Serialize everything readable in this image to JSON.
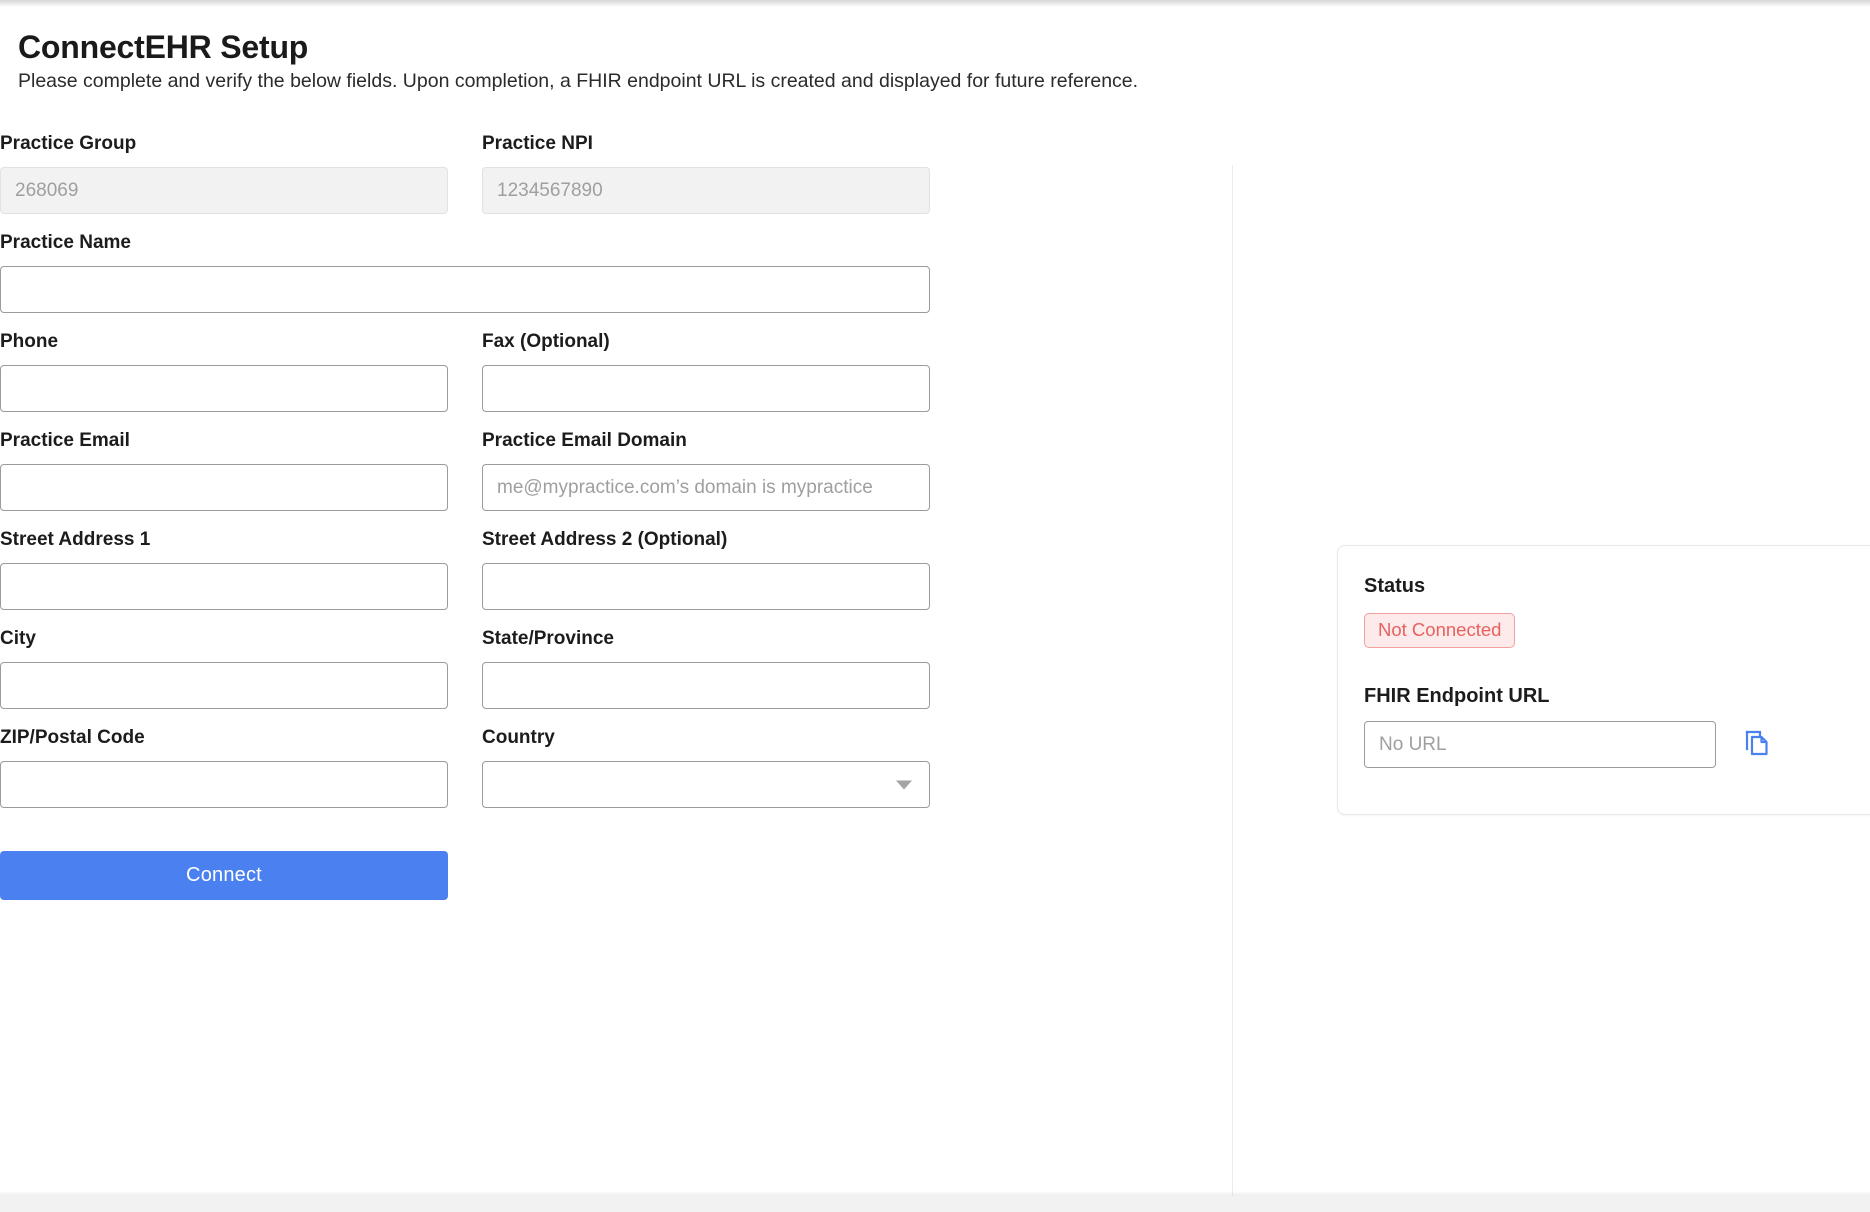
{
  "page": {
    "title": "ConnectEHR Setup",
    "subtitle": "Please complete and verify the below fields. Upon completion, a FHIR endpoint URL is created and displayed for future reference."
  },
  "form": {
    "practice_group": {
      "label": "Practice Group",
      "value": "268069",
      "placeholder": "268069"
    },
    "practice_npi": {
      "label": "Practice NPI",
      "value": "1234567890",
      "placeholder": "1234567890"
    },
    "practice_name": {
      "label": "Practice Name",
      "value": "",
      "placeholder": ""
    },
    "phone": {
      "label": "Phone",
      "value": "",
      "placeholder": ""
    },
    "fax": {
      "label": "Fax (Optional)",
      "value": "",
      "placeholder": ""
    },
    "practice_email": {
      "label": "Practice Email",
      "value": "",
      "placeholder": ""
    },
    "practice_email_domain": {
      "label": "Practice Email Domain",
      "value": "",
      "placeholder": "me@mypractice.com’s domain is mypractice"
    },
    "street_address_1": {
      "label": "Street Address 1",
      "value": "",
      "placeholder": ""
    },
    "street_address_2": {
      "label": "Street Address 2 (Optional)",
      "value": "",
      "placeholder": ""
    },
    "city": {
      "label": "City",
      "value": "",
      "placeholder": ""
    },
    "state_province": {
      "label": "State/Province",
      "value": "",
      "placeholder": ""
    },
    "zip_postal_code": {
      "label": "ZIP/Postal Code",
      "value": "",
      "placeholder": ""
    },
    "country": {
      "label": "Country",
      "selected": "",
      "options": [
        ""
      ]
    },
    "submit_label": "Connect"
  },
  "status_panel": {
    "status_heading": "Status",
    "status_badge": "Not Connected",
    "url_heading": "FHIR Endpoint URL",
    "url_value": "",
    "url_placeholder": "No URL",
    "copy_icon": "copy-icon"
  },
  "colors": {
    "accent": "#4a80ef",
    "status_text": "#e8615f",
    "status_bg": "#fdeaea",
    "status_border": "#f2a0a0",
    "copy_icon": "#4a80ef"
  }
}
